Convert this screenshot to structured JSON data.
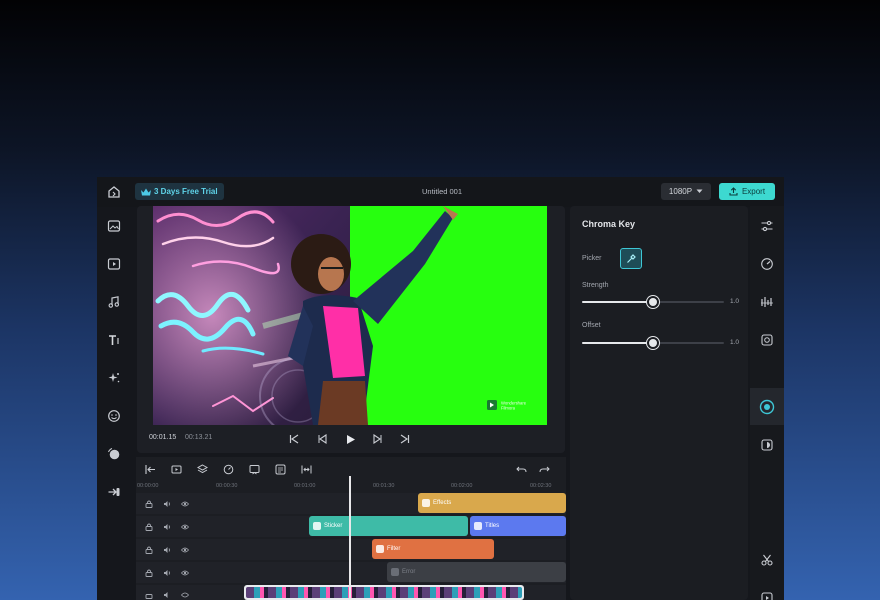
{
  "app": {
    "title": "Untitled 001",
    "trial_badge": "3 Days Free Trial",
    "resolution": "1080P",
    "export_label": "Export"
  },
  "left_rail": {
    "items": [
      {
        "icon": "image-icon"
      },
      {
        "icon": "video-icon"
      },
      {
        "icon": "music-icon"
      },
      {
        "icon": "text-icon"
      },
      {
        "icon": "effects-icon"
      },
      {
        "icon": "sticker-icon"
      },
      {
        "icon": "filter-icon"
      },
      {
        "icon": "transition-icon"
      }
    ]
  },
  "preview": {
    "current_time": "00:01.15",
    "total_time": "00:13.21",
    "watermark": "Wondershare Filmora"
  },
  "timeline": {
    "ruler": [
      "00:00:00",
      "00:00:30",
      "00:01:00",
      "00:01:30",
      "00:02:00",
      "00:02:30"
    ],
    "clips": {
      "effects": "Effects",
      "sticker": "Sticker",
      "titles": "Titles",
      "filter": "Filter",
      "error": "Error"
    }
  },
  "properties": {
    "title": "Chroma Key",
    "picker_label": "Picker",
    "strength_label": "Strength",
    "strength_value": "1.0",
    "strength_fraction": 0.5,
    "offset_label": "Offset",
    "offset_value": "1.0",
    "offset_fraction": 0.5
  },
  "colors": {
    "accent": "#3dd9d0",
    "green_screen": "#27ff0f",
    "effects_clip": "#d9a84c",
    "sticker_clip": "#3ebba7",
    "titles_clip": "#5c79ef",
    "filter_clip": "#e07142",
    "error_clip": "#3c3f45"
  }
}
